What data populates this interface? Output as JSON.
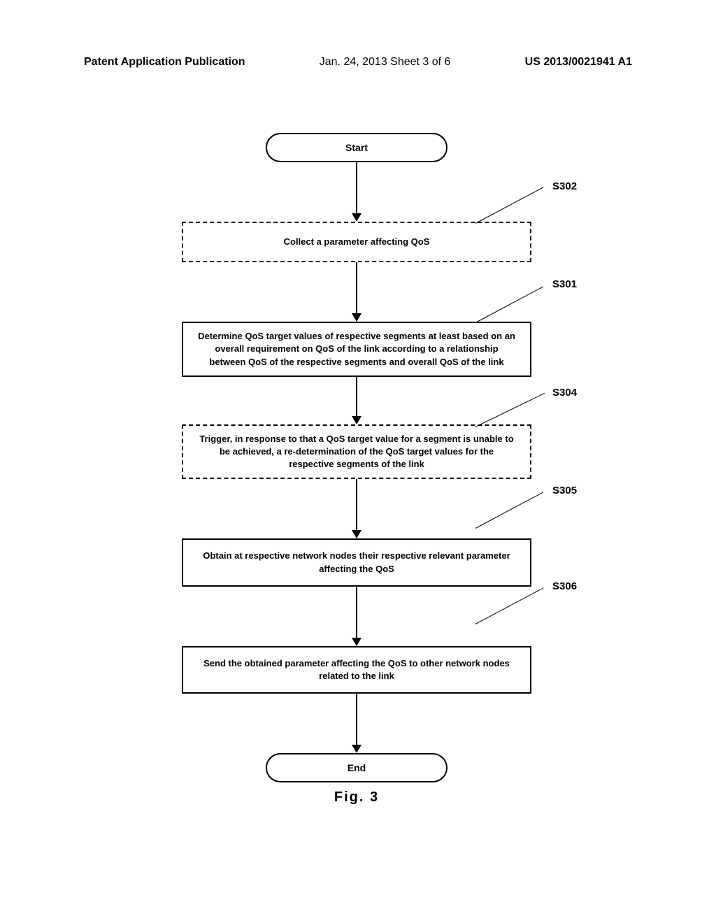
{
  "header": {
    "left": "Patent Application Publication",
    "center": "Jan. 24, 2013  Sheet 3 of 6",
    "right": "US 2013/0021941 A1"
  },
  "flowchart": {
    "start": "Start",
    "step_s302": {
      "label": "S302",
      "text": "Collect a parameter affecting QoS"
    },
    "step_s301": {
      "label": "S301",
      "text": "Determine QoS target values of respective segments at least based on an overall requirement on QoS of the link according to a relationship between QoS of the respective segments and overall QoS of the link"
    },
    "step_s304": {
      "label": "S304",
      "text": "Trigger, in response to that a QoS target value for a segment is unable to be achieved, a re-determination of the QoS target values for the respective segments of the link"
    },
    "step_s305": {
      "label": "S305",
      "text": "Obtain at respective network nodes their respective relevant parameter affecting the QoS"
    },
    "step_s306": {
      "label": "S306",
      "text": "Send the obtained parameter affecting the QoS to other network nodes related to the link"
    },
    "end": "End",
    "caption": "Fig. 3"
  }
}
